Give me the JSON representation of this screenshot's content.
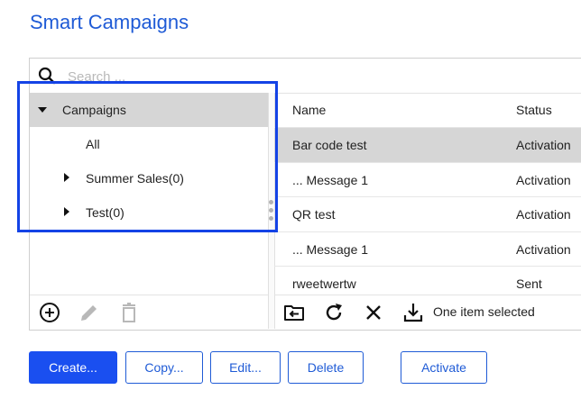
{
  "page": {
    "title": "Smart Campaigns"
  },
  "search": {
    "placeholder": "Search ..."
  },
  "tree": {
    "items": [
      {
        "label": "Campaigns",
        "expanded": true,
        "selected": true
      },
      {
        "label": "All"
      },
      {
        "label": "Summer Sales(0)",
        "expanded": false
      },
      {
        "label": "Test(0)",
        "expanded": false
      }
    ]
  },
  "tree_toolbar": {
    "icons": [
      "add-circle-icon",
      "pencil-icon",
      "trash-icon"
    ]
  },
  "table": {
    "columns": [
      "Name",
      "Status"
    ],
    "rows": [
      {
        "name": "Bar code test",
        "status": "Activation",
        "selected": true
      },
      {
        "name": "... Message 1",
        "status": "Activation"
      },
      {
        "name": "QR test",
        "status": "Activation"
      },
      {
        "name": "... Message 1",
        "status": "Activation"
      },
      {
        "name": "rweetwertw",
        "status": "Sent"
      }
    ]
  },
  "table_toolbar": {
    "icons": [
      "move-to-folder-icon",
      "refresh-icon",
      "close-icon",
      "download-icon"
    ],
    "selection_text": "One item selected"
  },
  "buttons": {
    "create": "Create...",
    "copy": "Copy...",
    "edit": "Edit...",
    "delete": "Delete",
    "activate": "Activate"
  },
  "colors": {
    "accent": "#1f5bd6",
    "primary_button": "#1a4ff0",
    "selection": "#d6d6d6",
    "highlight": "#1443e6"
  }
}
